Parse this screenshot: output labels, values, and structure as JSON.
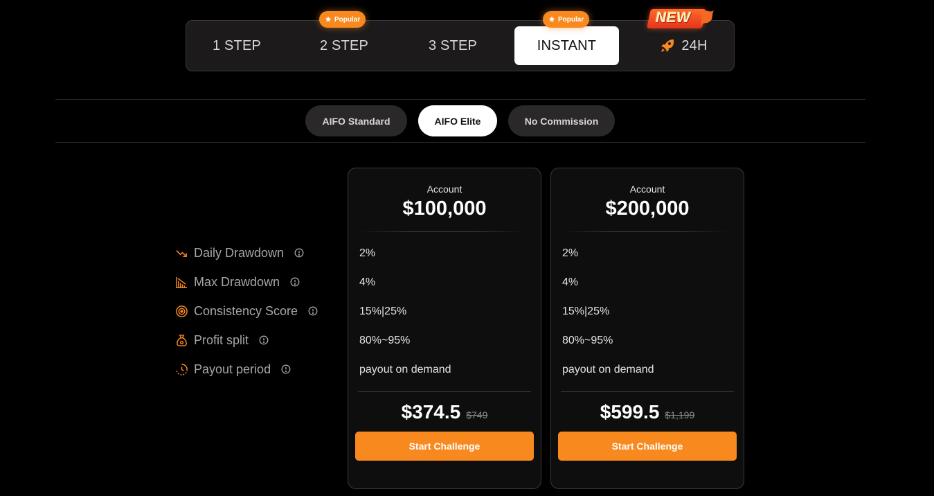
{
  "steps": {
    "tabs": [
      {
        "label": "1 STEP"
      },
      {
        "label": "2 STEP"
      },
      {
        "label": "3 STEP"
      },
      {
        "label": "INSTANT"
      },
      {
        "label": "24H"
      }
    ],
    "popular_badge": "Popular",
    "new_badge": "NEW",
    "active_tab": "INSTANT"
  },
  "account_types": {
    "options": [
      "AIFO Standard",
      "AIFO Elite",
      "No Commission"
    ],
    "active": "AIFO Elite"
  },
  "features": [
    {
      "label": "Daily Drawdown",
      "icon": "trend-down-icon"
    },
    {
      "label": "Max Drawdown",
      "icon": "bar-chart-down-icon"
    },
    {
      "label": "Consistency Score",
      "icon": "target-icon"
    },
    {
      "label": "Profit split",
      "icon": "money-bag-icon"
    },
    {
      "label": "Payout period",
      "icon": "clock-icon"
    }
  ],
  "plans": [
    {
      "account_label": "Account",
      "account_size": "$100,000",
      "values": [
        "2%",
        "4%",
        "15%|25%",
        "80%~95%",
        "payout on demand"
      ],
      "price": "$374.5",
      "old_price": "$749",
      "cta": "Start Challenge"
    },
    {
      "account_label": "Account",
      "account_size": "$200,000",
      "values": [
        "2%",
        "4%",
        "15%|25%",
        "80%~95%",
        "payout on demand"
      ],
      "price": "$599.5",
      "old_price": "$1,199",
      "cta": "Start Challenge"
    }
  ],
  "colors": {
    "accent": "#f7891f",
    "background": "#000000",
    "card": "#0e0e0e"
  }
}
